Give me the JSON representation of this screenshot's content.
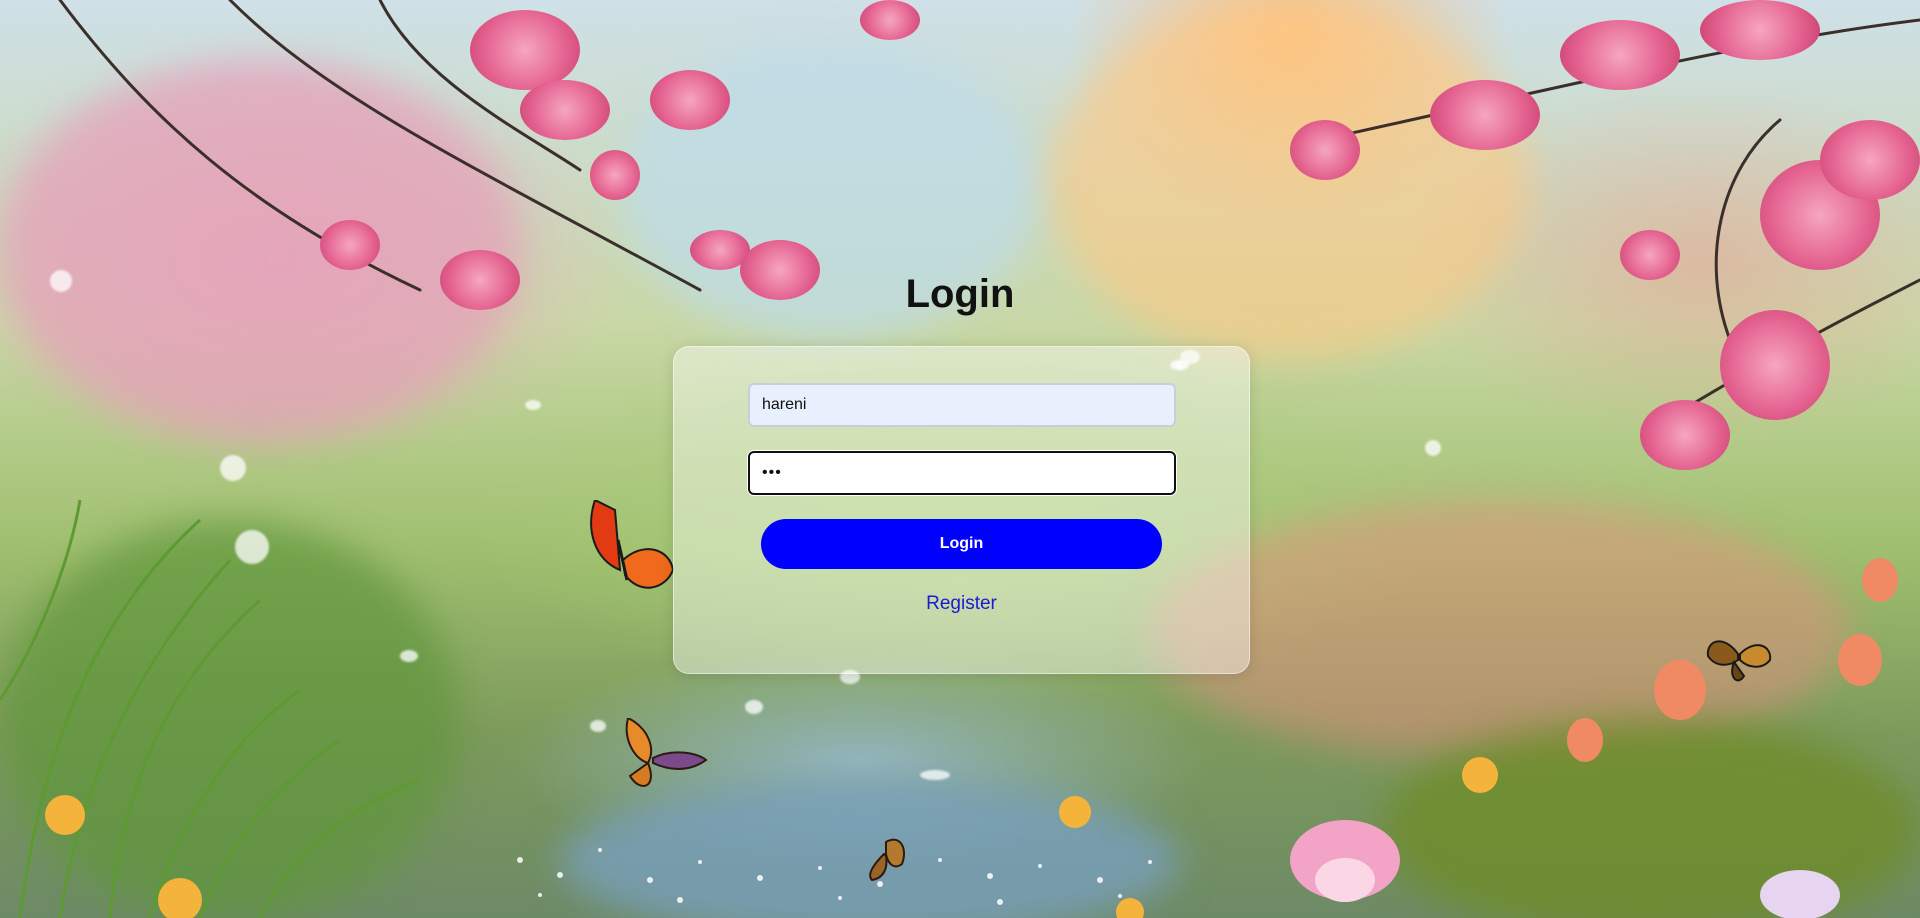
{
  "page": {
    "title": "Login"
  },
  "form": {
    "username_value": "hareni",
    "password_value": "•••",
    "login_label": "Login",
    "register_label": "Register"
  },
  "colors": {
    "button": "#0000ff",
    "link": "#1a1ad0",
    "card": "rgba(255,255,255,0.42)",
    "username_bg": "#e8f0fe"
  },
  "background": {
    "scene": "spring garden with cherry blossoms, butterflies and pond"
  }
}
